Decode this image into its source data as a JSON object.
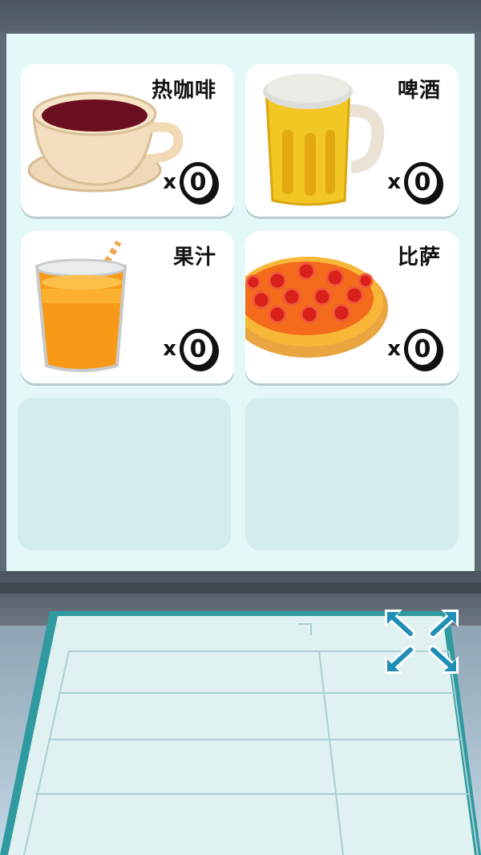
{
  "menu": {
    "items": [
      {
        "name": "热咖啡",
        "count_prefix": "x",
        "count": "0",
        "icon": "hot-coffee-cup"
      },
      {
        "name": "啤酒",
        "count_prefix": "x",
        "count": "0",
        "icon": "beer-mug"
      },
      {
        "name": "果汁",
        "count_prefix": "x",
        "count": "0",
        "icon": "juice-glass"
      },
      {
        "name": "比萨",
        "count_prefix": "x",
        "count": "0",
        "icon": "pizza"
      }
    ],
    "empty_slots": 2
  },
  "controls": {
    "resize_icon": "expand-arrows-icon"
  },
  "colors": {
    "panel": "#e4f8f8",
    "card": "#ffffff",
    "empty_slot": "#d3ecee",
    "accent_blue": "#1f8fb8"
  }
}
